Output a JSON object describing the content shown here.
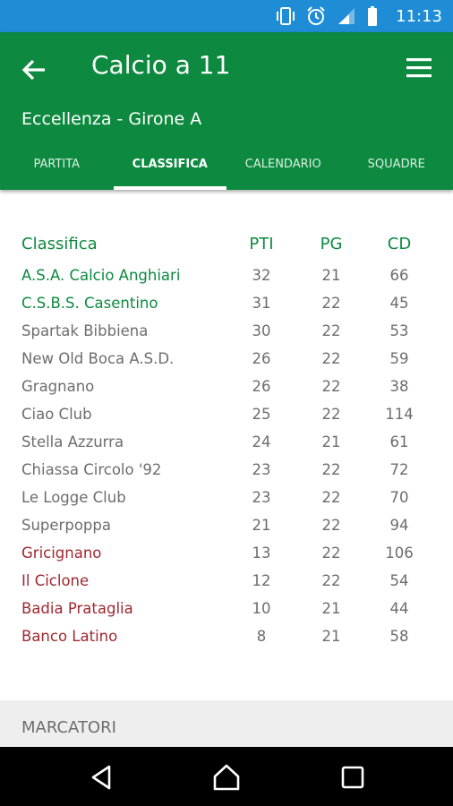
{
  "status_bar": {
    "time": "11:13",
    "icons": [
      "vibrate-icon",
      "alarm-icon",
      "signal-icon",
      "battery-icon"
    ]
  },
  "app_bar": {
    "title": "Calcio a 11",
    "subtitle": "Eccellenza - Girone A"
  },
  "tabs": [
    {
      "label": "PARTITA",
      "active": false
    },
    {
      "label": "CLASSIFICA",
      "active": true
    },
    {
      "label": "CALENDARIO",
      "active": false
    },
    {
      "label": "SQUADRE",
      "active": false
    }
  ],
  "standings": {
    "headers": {
      "team": "Classifica",
      "pti": "PTI",
      "pg": "PG",
      "cd": "CD"
    },
    "rows": [
      {
        "team": "A.S.A. Calcio Anghiari",
        "pti": "32",
        "pg": "21",
        "cd": "66",
        "zone": "promo"
      },
      {
        "team": "C.S.B.S. Casentino",
        "pti": "31",
        "pg": "22",
        "cd": "45",
        "zone": "promo"
      },
      {
        "team": "Spartak Bibbiena",
        "pti": "30",
        "pg": "22",
        "cd": "53",
        "zone": "normal"
      },
      {
        "team": "New Old Boca A.S.D.",
        "pti": "26",
        "pg": "22",
        "cd": "59",
        "zone": "normal"
      },
      {
        "team": "Gragnano",
        "pti": "26",
        "pg": "22",
        "cd": "38",
        "zone": "normal"
      },
      {
        "team": "Ciao Club",
        "pti": "25",
        "pg": "22",
        "cd": "114",
        "zone": "normal"
      },
      {
        "team": "Stella Azzurra",
        "pti": "24",
        "pg": "21",
        "cd": "61",
        "zone": "normal"
      },
      {
        "team": "Chiassa Circolo '92",
        "pti": "23",
        "pg": "22",
        "cd": "72",
        "zone": "normal"
      },
      {
        "team": "Le Logge Club",
        "pti": "23",
        "pg": "22",
        "cd": "70",
        "zone": "normal"
      },
      {
        "team": "Superpoppa",
        "pti": "21",
        "pg": "22",
        "cd": "94",
        "zone": "normal"
      },
      {
        "team": "Gricignano",
        "pti": "13",
        "pg": "22",
        "cd": "106",
        "zone": "releg"
      },
      {
        "team": "Il Ciclone",
        "pti": "12",
        "pg": "22",
        "cd": "54",
        "zone": "releg"
      },
      {
        "team": "Badia Prataglia",
        "pti": "10",
        "pg": "21",
        "cd": "44",
        "zone": "releg"
      },
      {
        "team": "Banco Latino",
        "pti": "8",
        "pg": "21",
        "cd": "58",
        "zone": "releg"
      }
    ]
  },
  "marcatori": {
    "label": "MARCATORI"
  },
  "colors": {
    "status_bar": "#1e8dd6",
    "app_bar": "#0d8a3f",
    "promo_text": "#0d8a3f",
    "releg_text": "#a02830",
    "normal_text": "#6d6d6d"
  }
}
